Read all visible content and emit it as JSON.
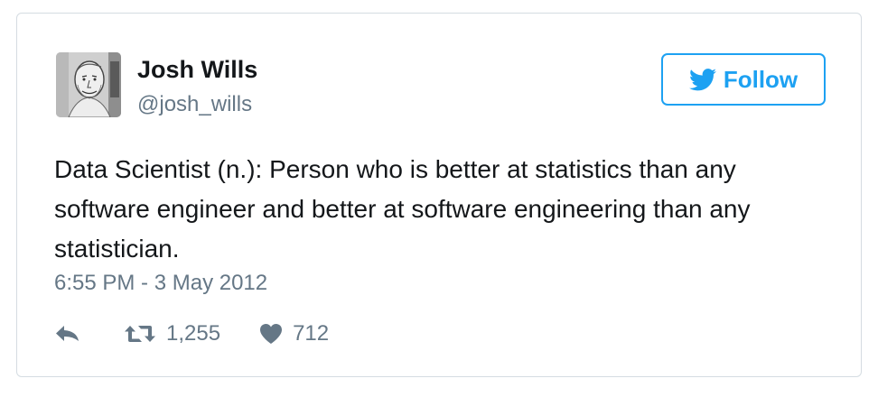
{
  "user": {
    "name": "Josh Wills",
    "handle": "@josh_wills"
  },
  "follow_button": {
    "label": "Follow",
    "icon": "twitter-bird-icon"
  },
  "tweet": {
    "text": "Data Scientist (n.): Person who is better at statistics than any software engineer and better at software engineering than any statistician.",
    "timestamp": "6:55 PM - 3 May 2012"
  },
  "actions": {
    "reply": {
      "icon": "reply-icon"
    },
    "retweet": {
      "icon": "retweet-icon",
      "count": "1,255"
    },
    "like": {
      "icon": "heart-icon",
      "count": "712"
    }
  },
  "colors": {
    "accent": "#1da1f2",
    "text": "#14171a",
    "muted": "#657786",
    "border": "#d5dce2"
  }
}
